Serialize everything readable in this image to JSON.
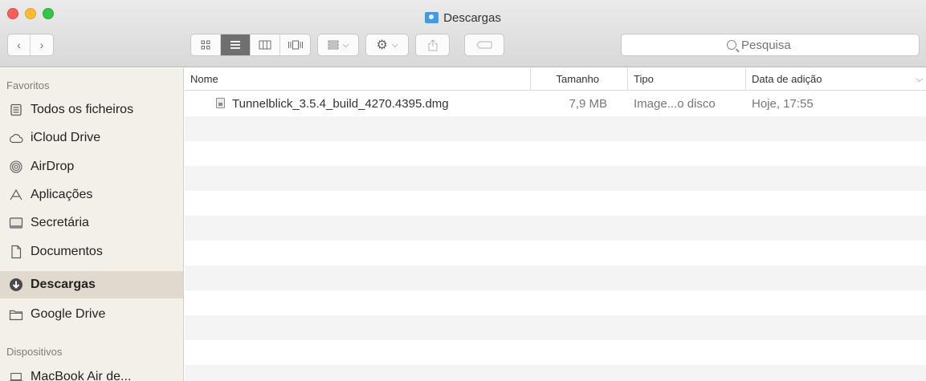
{
  "window": {
    "title": "Descargas"
  },
  "toolbar": {
    "search_placeholder": "Pesquisa"
  },
  "sidebar": {
    "sections": [
      {
        "header": "Favoritos",
        "items": [
          {
            "label": "Todos os ficheiros",
            "icon": "all-files-icon"
          },
          {
            "label": "iCloud Drive",
            "icon": "cloud-icon"
          },
          {
            "label": "AirDrop",
            "icon": "airdrop-icon"
          },
          {
            "label": "Aplicações",
            "icon": "applications-icon"
          },
          {
            "label": "Secretária",
            "icon": "desktop-icon"
          },
          {
            "label": "Documentos",
            "icon": "documents-icon"
          },
          {
            "label": "Descargas",
            "icon": "downloads-icon",
            "selected": true
          },
          {
            "label": "Google Drive",
            "icon": "folder-icon"
          }
        ]
      },
      {
        "header": "Dispositivos",
        "items": [
          {
            "label": "MacBook Air de...",
            "icon": "laptop-icon"
          }
        ]
      }
    ]
  },
  "file_list": {
    "columns": [
      "Nome",
      "Tamanho",
      "Tipo",
      "Data de adição"
    ],
    "rows": [
      {
        "name": "Tunnelblick_3.5.4_build_4270.4395.dmg",
        "size": "7,9 MB",
        "type": "Image...o disco",
        "date": "Hoje, 17:55"
      }
    ]
  },
  "colors": {
    "sidebar_bg": "#f3efe9",
    "selected_bg": "#e2d9ce",
    "close": "#fc5f57",
    "minimize": "#fdbc2e",
    "maximize": "#33c748"
  }
}
